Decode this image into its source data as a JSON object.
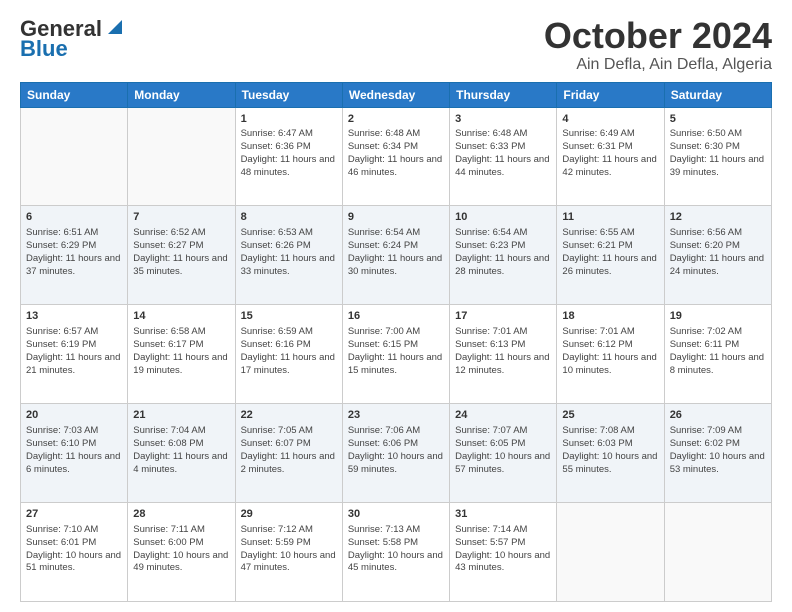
{
  "header": {
    "logo_text_general": "General",
    "logo_text_blue": "Blue",
    "month": "October 2024",
    "location": "Ain Defla, Ain Defla, Algeria"
  },
  "days_of_week": [
    "Sunday",
    "Monday",
    "Tuesday",
    "Wednesday",
    "Thursday",
    "Friday",
    "Saturday"
  ],
  "weeks": [
    [
      {
        "day": "",
        "info": ""
      },
      {
        "day": "",
        "info": ""
      },
      {
        "day": "1",
        "info": "Sunrise: 6:47 AM\nSunset: 6:36 PM\nDaylight: 11 hours and 48 minutes."
      },
      {
        "day": "2",
        "info": "Sunrise: 6:48 AM\nSunset: 6:34 PM\nDaylight: 11 hours and 46 minutes."
      },
      {
        "day": "3",
        "info": "Sunrise: 6:48 AM\nSunset: 6:33 PM\nDaylight: 11 hours and 44 minutes."
      },
      {
        "day": "4",
        "info": "Sunrise: 6:49 AM\nSunset: 6:31 PM\nDaylight: 11 hours and 42 minutes."
      },
      {
        "day": "5",
        "info": "Sunrise: 6:50 AM\nSunset: 6:30 PM\nDaylight: 11 hours and 39 minutes."
      }
    ],
    [
      {
        "day": "6",
        "info": "Sunrise: 6:51 AM\nSunset: 6:29 PM\nDaylight: 11 hours and 37 minutes."
      },
      {
        "day": "7",
        "info": "Sunrise: 6:52 AM\nSunset: 6:27 PM\nDaylight: 11 hours and 35 minutes."
      },
      {
        "day": "8",
        "info": "Sunrise: 6:53 AM\nSunset: 6:26 PM\nDaylight: 11 hours and 33 minutes."
      },
      {
        "day": "9",
        "info": "Sunrise: 6:54 AM\nSunset: 6:24 PM\nDaylight: 11 hours and 30 minutes."
      },
      {
        "day": "10",
        "info": "Sunrise: 6:54 AM\nSunset: 6:23 PM\nDaylight: 11 hours and 28 minutes."
      },
      {
        "day": "11",
        "info": "Sunrise: 6:55 AM\nSunset: 6:21 PM\nDaylight: 11 hours and 26 minutes."
      },
      {
        "day": "12",
        "info": "Sunrise: 6:56 AM\nSunset: 6:20 PM\nDaylight: 11 hours and 24 minutes."
      }
    ],
    [
      {
        "day": "13",
        "info": "Sunrise: 6:57 AM\nSunset: 6:19 PM\nDaylight: 11 hours and 21 minutes."
      },
      {
        "day": "14",
        "info": "Sunrise: 6:58 AM\nSunset: 6:17 PM\nDaylight: 11 hours and 19 minutes."
      },
      {
        "day": "15",
        "info": "Sunrise: 6:59 AM\nSunset: 6:16 PM\nDaylight: 11 hours and 17 minutes."
      },
      {
        "day": "16",
        "info": "Sunrise: 7:00 AM\nSunset: 6:15 PM\nDaylight: 11 hours and 15 minutes."
      },
      {
        "day": "17",
        "info": "Sunrise: 7:01 AM\nSunset: 6:13 PM\nDaylight: 11 hours and 12 minutes."
      },
      {
        "day": "18",
        "info": "Sunrise: 7:01 AM\nSunset: 6:12 PM\nDaylight: 11 hours and 10 minutes."
      },
      {
        "day": "19",
        "info": "Sunrise: 7:02 AM\nSunset: 6:11 PM\nDaylight: 11 hours and 8 minutes."
      }
    ],
    [
      {
        "day": "20",
        "info": "Sunrise: 7:03 AM\nSunset: 6:10 PM\nDaylight: 11 hours and 6 minutes."
      },
      {
        "day": "21",
        "info": "Sunrise: 7:04 AM\nSunset: 6:08 PM\nDaylight: 11 hours and 4 minutes."
      },
      {
        "day": "22",
        "info": "Sunrise: 7:05 AM\nSunset: 6:07 PM\nDaylight: 11 hours and 2 minutes."
      },
      {
        "day": "23",
        "info": "Sunrise: 7:06 AM\nSunset: 6:06 PM\nDaylight: 10 hours and 59 minutes."
      },
      {
        "day": "24",
        "info": "Sunrise: 7:07 AM\nSunset: 6:05 PM\nDaylight: 10 hours and 57 minutes."
      },
      {
        "day": "25",
        "info": "Sunrise: 7:08 AM\nSunset: 6:03 PM\nDaylight: 10 hours and 55 minutes."
      },
      {
        "day": "26",
        "info": "Sunrise: 7:09 AM\nSunset: 6:02 PM\nDaylight: 10 hours and 53 minutes."
      }
    ],
    [
      {
        "day": "27",
        "info": "Sunrise: 7:10 AM\nSunset: 6:01 PM\nDaylight: 10 hours and 51 minutes."
      },
      {
        "day": "28",
        "info": "Sunrise: 7:11 AM\nSunset: 6:00 PM\nDaylight: 10 hours and 49 minutes."
      },
      {
        "day": "29",
        "info": "Sunrise: 7:12 AM\nSunset: 5:59 PM\nDaylight: 10 hours and 47 minutes."
      },
      {
        "day": "30",
        "info": "Sunrise: 7:13 AM\nSunset: 5:58 PM\nDaylight: 10 hours and 45 minutes."
      },
      {
        "day": "31",
        "info": "Sunrise: 7:14 AM\nSunset: 5:57 PM\nDaylight: 10 hours and 43 minutes."
      },
      {
        "day": "",
        "info": ""
      },
      {
        "day": "",
        "info": ""
      }
    ]
  ]
}
